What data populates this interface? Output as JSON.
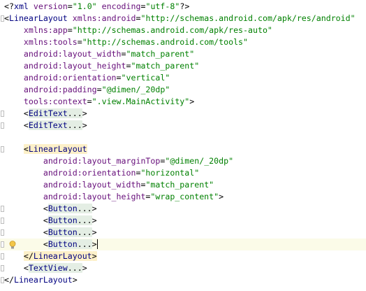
{
  "editor": {
    "lines": [
      [
        [
          "tok-punct",
          "<?"
        ],
        [
          "tok-decl",
          "xml "
        ],
        [
          "tok-attr",
          "version"
        ],
        [
          "tok-punct",
          "="
        ],
        [
          "tok-val",
          "\"1.0\""
        ],
        [
          "tok-punct",
          " "
        ],
        [
          "tok-attr",
          "encoding"
        ],
        [
          "tok-punct",
          "="
        ],
        [
          "tok-val",
          "\"utf-8\""
        ],
        [
          "tok-punct",
          "?>"
        ]
      ],
      [
        [
          "tok-punct",
          "<"
        ],
        [
          "tok-tag",
          "LinearLayout "
        ],
        [
          "tok-ns",
          "xmlns:android"
        ],
        [
          "tok-punct",
          "="
        ],
        [
          "tok-val",
          "\"http://schemas.android.com/apk/res/android\""
        ]
      ],
      [
        [
          "tok-ns",
          "    xmlns:app"
        ],
        [
          "tok-punct",
          "="
        ],
        [
          "tok-val",
          "\"http://schemas.android.com/apk/res-auto\""
        ]
      ],
      [
        [
          "tok-ns",
          "    xmlns:tools"
        ],
        [
          "tok-punct",
          "="
        ],
        [
          "tok-val",
          "\"http://schemas.android.com/tools\""
        ]
      ],
      [
        [
          "tok-attr",
          "    android:layout_width"
        ],
        [
          "tok-punct",
          "="
        ],
        [
          "tok-val",
          "\"match_parent\""
        ]
      ],
      [
        [
          "tok-attr",
          "    android:layout_height"
        ],
        [
          "tok-punct",
          "="
        ],
        [
          "tok-val",
          "\"match_parent\""
        ]
      ],
      [
        [
          "tok-attr",
          "    android:orientation"
        ],
        [
          "tok-punct",
          "="
        ],
        [
          "tok-val",
          "\"vertical\""
        ]
      ],
      [
        [
          "tok-attr",
          "    android:padding"
        ],
        [
          "tok-punct",
          "="
        ],
        [
          "tok-val",
          "\"@dimen/_20dp\""
        ]
      ],
      [
        [
          "tok-attr",
          "    tools:context"
        ],
        [
          "tok-punct",
          "="
        ],
        [
          "tok-val",
          "\".view.MainActivity\""
        ],
        [
          "tok-punct",
          ">"
        ]
      ],
      [
        [
          "tok-punct",
          "    <"
        ],
        [
          "tok-tag folded",
          "EditText"
        ],
        [
          "tok-punct folded",
          "..."
        ],
        [
          "tok-punct",
          ">"
        ]
      ],
      [
        [
          "tok-punct",
          "    <"
        ],
        [
          "tok-tag folded",
          "EditText"
        ],
        [
          "tok-punct folded",
          "..."
        ],
        [
          "tok-punct",
          ">"
        ]
      ],
      [
        [
          "tok-punct",
          ""
        ]
      ],
      [
        [
          "tok-punct",
          "    "
        ],
        [
          "tok-punct tag-hl",
          "<"
        ],
        [
          "tok-tag tag-hl",
          "LinearLayout"
        ]
      ],
      [
        [
          "tok-attr",
          "        android:layout_marginTop"
        ],
        [
          "tok-punct",
          "="
        ],
        [
          "tok-val",
          "\"@dimen/_20dp\""
        ]
      ],
      [
        [
          "tok-attr",
          "        android:orientation"
        ],
        [
          "tok-punct",
          "="
        ],
        [
          "tok-val",
          "\"horizontal\""
        ]
      ],
      [
        [
          "tok-attr",
          "        android:layout_width"
        ],
        [
          "tok-punct",
          "="
        ],
        [
          "tok-val",
          "\"match_parent\""
        ]
      ],
      [
        [
          "tok-attr",
          "        android:layout_height"
        ],
        [
          "tok-punct",
          "="
        ],
        [
          "tok-val",
          "\"wrap_content\""
        ],
        [
          "tok-punct",
          ">"
        ]
      ],
      [
        [
          "tok-punct",
          "        <"
        ],
        [
          "tok-tag folded",
          "Button"
        ],
        [
          "tok-punct folded",
          "..."
        ],
        [
          "tok-punct",
          ">"
        ]
      ],
      [
        [
          "tok-punct",
          "        <"
        ],
        [
          "tok-tag folded",
          "Button"
        ],
        [
          "tok-punct folded",
          "..."
        ],
        [
          "tok-punct",
          ">"
        ]
      ],
      [
        [
          "tok-punct",
          "        <"
        ],
        [
          "tok-tag folded",
          "Button"
        ],
        [
          "tok-punct folded",
          "..."
        ],
        [
          "tok-punct",
          ">"
        ]
      ],
      [
        [
          "tok-punct",
          "        <"
        ],
        [
          "tok-tag folded",
          "Button"
        ],
        [
          "tok-punct folded",
          "..."
        ],
        [
          "tok-punct",
          ">"
        ]
      ],
      [
        [
          "tok-punct",
          "    "
        ],
        [
          "tok-punct tag-hl",
          "</"
        ],
        [
          "tok-tag tag-hl",
          "LinearLayout"
        ],
        [
          "tok-punct tag-hl",
          ">"
        ]
      ],
      [
        [
          "tok-punct",
          "    <"
        ],
        [
          "tok-tag folded",
          "TextView"
        ],
        [
          "tok-punct folded",
          "..."
        ],
        [
          "tok-punct",
          ">"
        ]
      ],
      [
        [
          "tok-punct",
          "</"
        ],
        [
          "tok-tag",
          "LinearLayout"
        ],
        [
          "tok-punct",
          ">"
        ]
      ]
    ],
    "current_line": 20,
    "bulb_line": 20,
    "fold_markers": [
      1,
      9,
      10,
      12,
      17,
      18,
      19,
      20,
      21,
      22,
      23
    ]
  }
}
